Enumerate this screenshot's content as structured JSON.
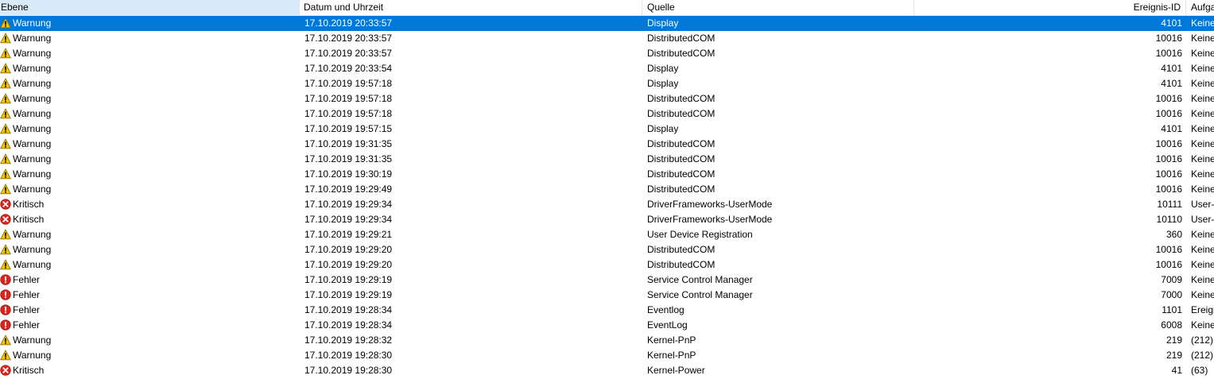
{
  "columns": {
    "level": "Ebene",
    "date": "Datum und Uhrzeit",
    "source": "Quelle",
    "event_id": "Ereignis-ID",
    "task": "Aufga"
  },
  "colors": {
    "selection": "#0078d7",
    "sorted_header": "#d9ebf9",
    "warning": "#f5c400",
    "error": "#d9251d"
  },
  "selected_row_index": 0,
  "rows": [
    {
      "icon": "warning-icon",
      "level": "Warnung",
      "date": "17.10.2019 20:33:57",
      "source": "Display",
      "id": "4101",
      "task": "Keine"
    },
    {
      "icon": "warning-icon",
      "level": "Warnung",
      "date": "17.10.2019 20:33:57",
      "source": "DistributedCOM",
      "id": "10016",
      "task": "Keine"
    },
    {
      "icon": "warning-icon",
      "level": "Warnung",
      "date": "17.10.2019 20:33:57",
      "source": "DistributedCOM",
      "id": "10016",
      "task": "Keine"
    },
    {
      "icon": "warning-icon",
      "level": "Warnung",
      "date": "17.10.2019 20:33:54",
      "source": "Display",
      "id": "4101",
      "task": "Keine"
    },
    {
      "icon": "warning-icon",
      "level": "Warnung",
      "date": "17.10.2019 19:57:18",
      "source": "Display",
      "id": "4101",
      "task": "Keine"
    },
    {
      "icon": "warning-icon",
      "level": "Warnung",
      "date": "17.10.2019 19:57:18",
      "source": "DistributedCOM",
      "id": "10016",
      "task": "Keine"
    },
    {
      "icon": "warning-icon",
      "level": "Warnung",
      "date": "17.10.2019 19:57:18",
      "source": "DistributedCOM",
      "id": "10016",
      "task": "Keine"
    },
    {
      "icon": "warning-icon",
      "level": "Warnung",
      "date": "17.10.2019 19:57:15",
      "source": "Display",
      "id": "4101",
      "task": "Keine"
    },
    {
      "icon": "warning-icon",
      "level": "Warnung",
      "date": "17.10.2019 19:31:35",
      "source": "DistributedCOM",
      "id": "10016",
      "task": "Keine"
    },
    {
      "icon": "warning-icon",
      "level": "Warnung",
      "date": "17.10.2019 19:31:35",
      "source": "DistributedCOM",
      "id": "10016",
      "task": "Keine"
    },
    {
      "icon": "warning-icon",
      "level": "Warnung",
      "date": "17.10.2019 19:30:19",
      "source": "DistributedCOM",
      "id": "10016",
      "task": "Keine"
    },
    {
      "icon": "warning-icon",
      "level": "Warnung",
      "date": "17.10.2019 19:29:49",
      "source": "DistributedCOM",
      "id": "10016",
      "task": "Keine"
    },
    {
      "icon": "critical-icon",
      "level": "Kritisch",
      "date": "17.10.2019 19:29:34",
      "source": "DriverFrameworks-UserMode",
      "id": "10111",
      "task": "User-"
    },
    {
      "icon": "critical-icon",
      "level": "Kritisch",
      "date": "17.10.2019 19:29:34",
      "source": "DriverFrameworks-UserMode",
      "id": "10110",
      "task": "User-"
    },
    {
      "icon": "warning-icon",
      "level": "Warnung",
      "date": "17.10.2019 19:29:21",
      "source": "User Device Registration",
      "id": "360",
      "task": "Keine"
    },
    {
      "icon": "warning-icon",
      "level": "Warnung",
      "date": "17.10.2019 19:29:20",
      "source": "DistributedCOM",
      "id": "10016",
      "task": "Keine"
    },
    {
      "icon": "warning-icon",
      "level": "Warnung",
      "date": "17.10.2019 19:29:20",
      "source": "DistributedCOM",
      "id": "10016",
      "task": "Keine"
    },
    {
      "icon": "error-icon",
      "level": "Fehler",
      "date": "17.10.2019 19:29:19",
      "source": "Service Control Manager",
      "id": "7009",
      "task": "Keine"
    },
    {
      "icon": "error-icon",
      "level": "Fehler",
      "date": "17.10.2019 19:29:19",
      "source": "Service Control Manager",
      "id": "7000",
      "task": "Keine"
    },
    {
      "icon": "error-icon",
      "level": "Fehler",
      "date": "17.10.2019 19:28:34",
      "source": "Eventlog",
      "id": "1101",
      "task": "Ereigr"
    },
    {
      "icon": "error-icon",
      "level": "Fehler",
      "date": "17.10.2019 19:28:34",
      "source": "EventLog",
      "id": "6008",
      "task": "Keine"
    },
    {
      "icon": "warning-icon",
      "level": "Warnung",
      "date": "17.10.2019 19:28:32",
      "source": "Kernel-PnP",
      "id": "219",
      "task": "(212)"
    },
    {
      "icon": "warning-icon",
      "level": "Warnung",
      "date": "17.10.2019 19:28:30",
      "source": "Kernel-PnP",
      "id": "219",
      "task": "(212)"
    },
    {
      "icon": "critical-icon",
      "level": "Kritisch",
      "date": "17.10.2019 19:28:30",
      "source": "Kernel-Power",
      "id": "41",
      "task": "(63)"
    }
  ]
}
